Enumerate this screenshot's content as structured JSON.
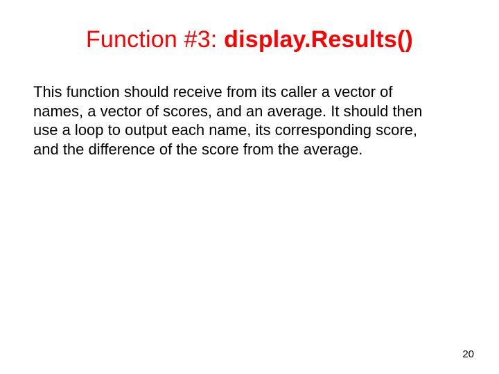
{
  "slide": {
    "title_prefix": "Function #3: ",
    "title_funcname": "display.Results()",
    "body": "This function should receive from its caller a vector of names, a vector of scores, and an average.  It should then use a loop to output each name, its corresponding score, and the difference of the score from the average.",
    "page_number": "20"
  },
  "colors": {
    "accent": "#ff0000",
    "text": "#000000",
    "background": "#ffffff"
  }
}
